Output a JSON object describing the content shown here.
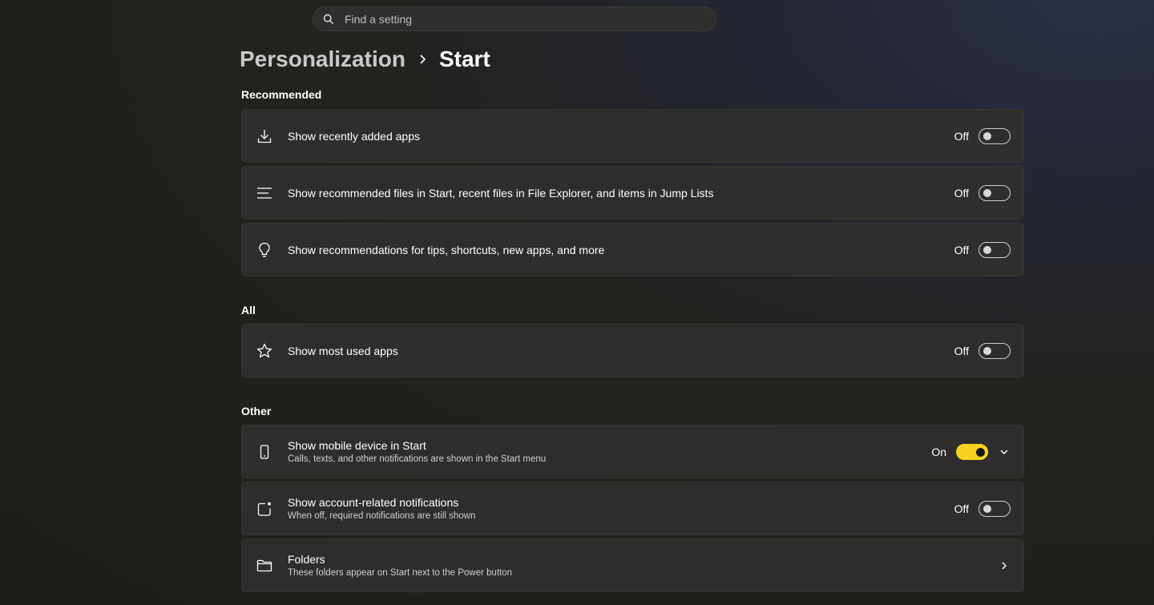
{
  "search": {
    "placeholder": "Find a setting"
  },
  "breadcrumb": {
    "parent": "Personalization",
    "current": "Start"
  },
  "sections": {
    "recommended": "Recommended",
    "all": "All",
    "other": "Other"
  },
  "settings": {
    "recent_apps": {
      "title": "Show recently added apps",
      "state": "Off"
    },
    "recommended_files": {
      "title": "Show recommended files in Start, recent files in File Explorer, and items in Jump Lists",
      "state": "Off"
    },
    "recommendations_tips": {
      "title": "Show recommendations for tips, shortcuts, new apps, and more",
      "state": "Off"
    },
    "most_used": {
      "title": "Show most used apps",
      "state": "Off"
    },
    "mobile_device": {
      "title": "Show mobile device in Start",
      "subtitle": "Calls, texts, and other notifications are shown in the Start menu",
      "state": "On"
    },
    "account_notifications": {
      "title": "Show account-related notifications",
      "subtitle": "When off, required notifications are still shown",
      "state": "Off"
    },
    "folders": {
      "title": "Folders",
      "subtitle": "These folders appear on Start next to the Power button"
    }
  },
  "colors": {
    "accent": "#f5d21f"
  }
}
